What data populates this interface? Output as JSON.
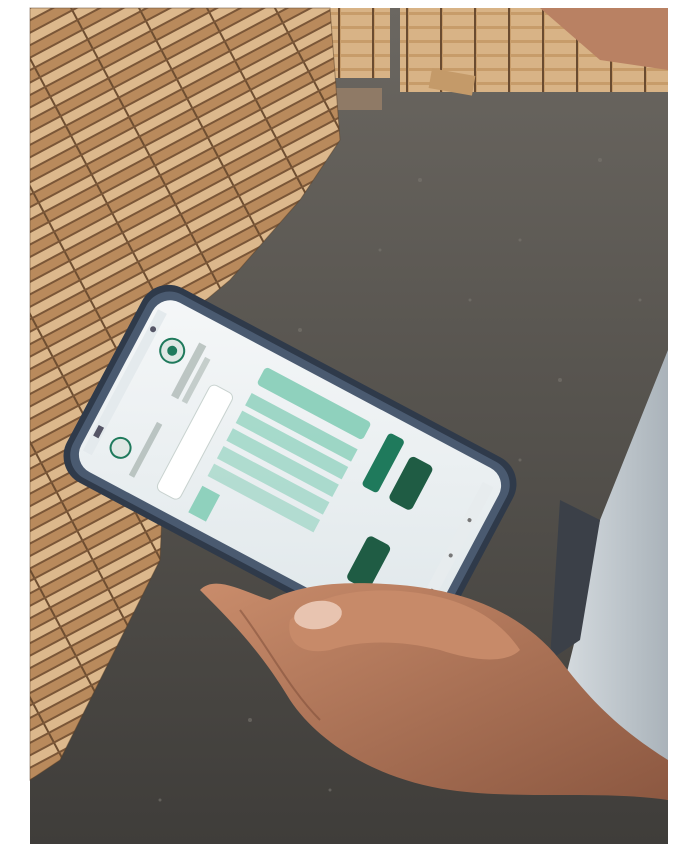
{
  "scene": {
    "kind": "photo",
    "subject": "hand-holding-smartphone",
    "background": "lumber-yard"
  },
  "colors": {
    "floor": "#5a5651",
    "lumber_light": "#d9b58a",
    "lumber_dark": "#a9794d",
    "lumber_shadow": "#6e4e31",
    "phone_frame": "#3d4a5c",
    "screen_bg": "#eef3f5",
    "app_accent": "#1f7a5c",
    "app_accent_light": "#8fd1bd",
    "skin": "#b57a5c",
    "skin_shadow": "#8a5640",
    "shirt": "#c9d0d6"
  },
  "phone_screen": {
    "status_bar_icons": [
      "signal-icon",
      "battery-icon"
    ],
    "buttons": [
      "",
      ""
    ],
    "table_rows": 5
  }
}
